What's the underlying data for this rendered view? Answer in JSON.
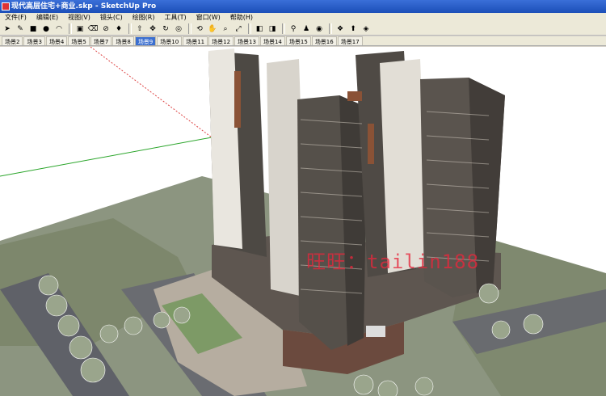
{
  "window": {
    "title": "现代高层住宅+商业.skp - SketchUp Pro"
  },
  "menu": [
    "文件(F)",
    "编辑(E)",
    "视图(V)",
    "镜头(C)",
    "绘图(R)",
    "工具(T)",
    "窗口(W)",
    "帮助(H)"
  ],
  "toolbar": [
    {
      "icon": "select-arrow-icon",
      "glyph": "➤"
    },
    {
      "icon": "pencil-icon",
      "glyph": "✎"
    },
    {
      "icon": "rectangle-icon",
      "glyph": "■"
    },
    {
      "icon": "circle-icon",
      "glyph": "●"
    },
    {
      "icon": "arc-icon",
      "glyph": "◠"
    },
    {
      "sep": true
    },
    {
      "icon": "make-component-icon",
      "glyph": "▣"
    },
    {
      "icon": "eraser-icon",
      "glyph": "⌫"
    },
    {
      "icon": "tape-measure-icon",
      "glyph": "⊘"
    },
    {
      "icon": "paint-bucket-icon",
      "glyph": "♦"
    },
    {
      "sep": true
    },
    {
      "icon": "push-pull-icon",
      "glyph": "⇧"
    },
    {
      "icon": "move-icon",
      "glyph": "✥"
    },
    {
      "icon": "rotate-icon",
      "glyph": "↻"
    },
    {
      "icon": "offset-icon",
      "glyph": "◎"
    },
    {
      "sep": true
    },
    {
      "icon": "orbit-icon",
      "glyph": "⟲"
    },
    {
      "icon": "pan-icon",
      "glyph": "✋"
    },
    {
      "icon": "zoom-icon",
      "glyph": "⌕"
    },
    {
      "icon": "zoom-extents-icon",
      "glyph": "⤢"
    },
    {
      "sep": true
    },
    {
      "icon": "previous-view-icon",
      "glyph": "◧"
    },
    {
      "icon": "next-view-icon",
      "glyph": "◨"
    },
    {
      "sep": true
    },
    {
      "icon": "position-camera-icon",
      "glyph": "⚲"
    },
    {
      "icon": "walk-icon",
      "glyph": "♟"
    },
    {
      "icon": "look-around-icon",
      "glyph": "◉"
    },
    {
      "sep": true
    },
    {
      "icon": "get-models-icon",
      "glyph": "❖"
    },
    {
      "icon": "share-model-icon",
      "glyph": "⬆"
    },
    {
      "icon": "extension-warehouse-icon",
      "glyph": "◈"
    }
  ],
  "scenes": [
    "场景2",
    "场景3",
    "场景4",
    "场景5",
    "场景7",
    "场景8",
    "场景9",
    "场景10",
    "场景11",
    "场景12",
    "场景13",
    "场景14",
    "场景15",
    "场景16",
    "场景17"
  ],
  "active_scene_index": 6,
  "watermark": "旺旺：tailin188",
  "colors": {
    "accent": "#3b6fd0",
    "titlebar": "#1c4fb8",
    "watermark": "#e6283c"
  }
}
